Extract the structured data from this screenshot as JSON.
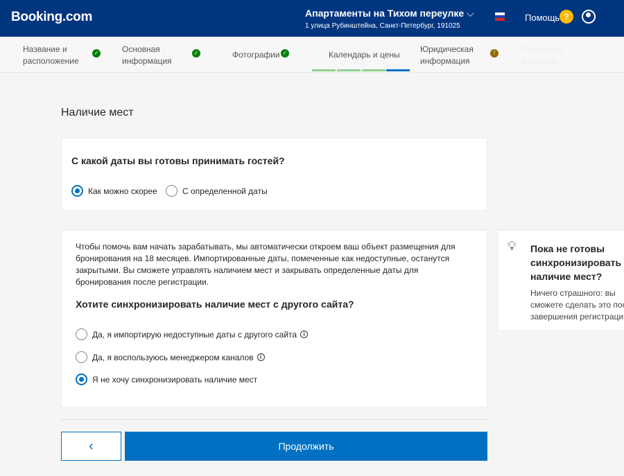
{
  "header": {
    "logo": "Booking.com",
    "property_name": "Апартаменты на Тихом переулке",
    "address": "1 улица Рубинштейна, Санкт-Петербург, 191025",
    "help": "Помощь",
    "help_icon": "?"
  },
  "steps": [
    {
      "line1": "Название и",
      "line2": "расположение",
      "status": "done"
    },
    {
      "line1": "Основная",
      "line2": "информация",
      "status": "done"
    },
    {
      "line1": "Фотографии",
      "status": "done"
    },
    {
      "line1": "Календарь и цены",
      "status": "current"
    },
    {
      "line1": "Юридическая",
      "line2": "информация",
      "status": "warning"
    },
    {
      "line1": "Платежи и",
      "line2": "финансы",
      "status": "disabled"
    }
  ],
  "page_title": "Наличие мест",
  "start_card": {
    "question": "С какой даты вы готовы принимать гостей?",
    "options": [
      "Как можно скорее",
      "С определенной даты"
    ],
    "selected": 0
  },
  "sync_card": {
    "intro": "Чтобы помочь вам начать зарабатывать, мы автоматически откроем ваш объект размещения для бронирования на 18 месяцев. Импортированные даты, помеченные как недоступные, останутся закрытыми. Вы сможете управлять наличием мест и закрывать определенные даты для бронирования после регистрации.",
    "question": "Хотите синхронизировать наличие мест с другого сайта?",
    "options": [
      "Да, я импортирую недоступные даты с другого сайта",
      "Да, я воспользуюсь менеджером каналов",
      "Я не хочу синхронизировать наличие мест"
    ],
    "selected": 2
  },
  "tip": {
    "title": "Пока не готовы синхронизировать наличие мест?",
    "text": "Ничего страшного: вы сможете сделать это после завершения регистрации."
  },
  "footer": {
    "back": "‹",
    "continue": "Продолжить"
  }
}
